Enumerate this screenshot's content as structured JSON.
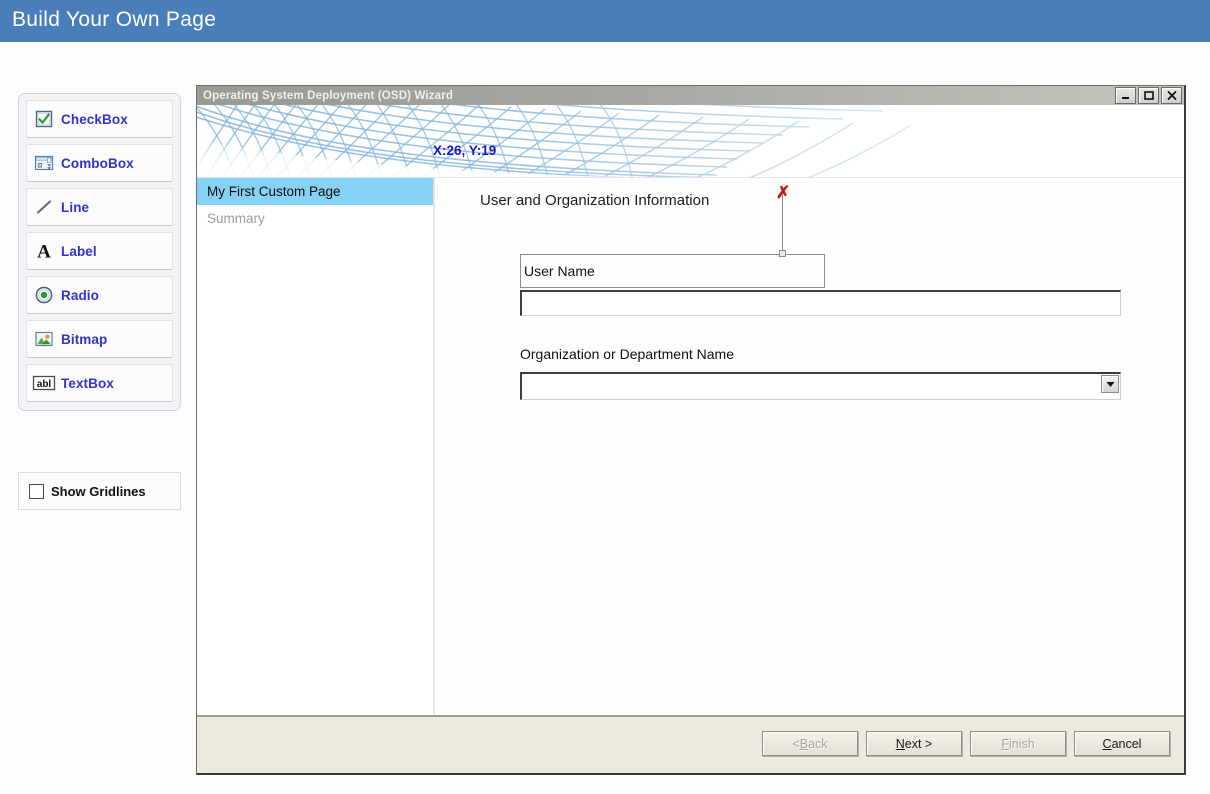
{
  "app": {
    "banner_title": "Build Your Own Page"
  },
  "toolbox": {
    "items": [
      {
        "label": "CheckBox",
        "icon": "checkbox-icon"
      },
      {
        "label": "ComboBox",
        "icon": "combobox-icon"
      },
      {
        "label": "Line",
        "icon": "line-icon"
      },
      {
        "label": "Label",
        "icon": "label-a-icon"
      },
      {
        "label": "Radio",
        "icon": "radio-icon"
      },
      {
        "label": "Bitmap",
        "icon": "bitmap-image-icon"
      },
      {
        "label": "TextBox",
        "icon": "textbox-abl-icon"
      }
    ]
  },
  "gridlines": {
    "label": "Show Gridlines",
    "checked": false
  },
  "wizard": {
    "title": "Operating System Deployment (OSD) Wizard",
    "window_buttons": {
      "minimize": "_",
      "maximize": "❐",
      "close": "✕"
    },
    "header": {
      "coordinates": "X:26, Y:19"
    },
    "nav": {
      "items": [
        {
          "label": "My First Custom Page",
          "state": "selected"
        },
        {
          "label": "Summary",
          "state": "dim"
        }
      ]
    },
    "content": {
      "heading": "User and Organization Information",
      "user_name_label": "User Name",
      "user_name_value": "",
      "organization_label": "Organization or Department Name",
      "organization_value": "",
      "organization_selected_option": ""
    },
    "footer": {
      "buttons": [
        {
          "prefix": "< ",
          "accel": "B",
          "suffix": "ack",
          "disabled": true
        },
        {
          "prefix": "",
          "accel": "N",
          "suffix": "ext >",
          "disabled": false
        },
        {
          "prefix": "",
          "accel": "F",
          "suffix": "inish",
          "disabled": true
        },
        {
          "prefix": "",
          "accel": "C",
          "suffix": "ancel",
          "disabled": false
        }
      ]
    }
  },
  "colors": {
    "banner_blue": "#4a7ebb",
    "tool_label_blue": "#3333cc",
    "nav_selected": "#86d2f5",
    "coord_text": "#1818c8",
    "marker_red": "#cc1414",
    "footer_beige": "#ece9de"
  }
}
